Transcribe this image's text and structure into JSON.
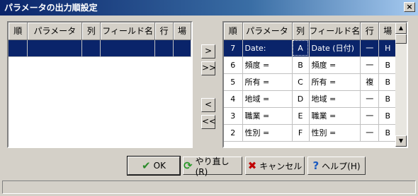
{
  "window": {
    "title": "パラメータの出力順設定",
    "close_label": "×"
  },
  "left_grid": {
    "columns": [
      "順",
      "パラメータ",
      "列",
      "フィールド名",
      "行",
      "場"
    ]
  },
  "right_grid": {
    "columns": [
      "順",
      "パラメータ",
      "列",
      "フィールド名",
      "行",
      "場"
    ],
    "rows": [
      [
        "7",
        "Date:",
        "A",
        "Date (日付)",
        "一",
        "H"
      ],
      [
        "6",
        "頻度 =",
        "B",
        "頻度 =",
        "一",
        "B"
      ],
      [
        "5",
        "所有 =",
        "C",
        "所有 =",
        "複",
        "B"
      ],
      [
        "4",
        "地域 =",
        "D",
        "地域 =",
        "一",
        "B"
      ],
      [
        "3",
        "職業 =",
        "E",
        "職業 =",
        "一",
        "B"
      ],
      [
        "2",
        "性別 =",
        "F",
        "性別 =",
        "一",
        "B"
      ]
    ]
  },
  "move_buttons": {
    "add": ">",
    "add_all": ">>",
    "remove": "<",
    "remove_all": "<<"
  },
  "buttons": {
    "ok": "OK",
    "redo": "やり直し(R)",
    "cancel": "キャンセル",
    "help": "ヘルプ(H)"
  },
  "icons": {
    "ok": "checkmark-icon",
    "redo": "refresh-icon",
    "cancel": "cross-icon",
    "help": "question-icon"
  },
  "colors": {
    "selection": "#0a246a",
    "ok_icon": "#2a8a2a",
    "redo_icon": "#2a9a2a",
    "cancel_icon": "#c00000",
    "help_icon": "#1a5ac0"
  }
}
